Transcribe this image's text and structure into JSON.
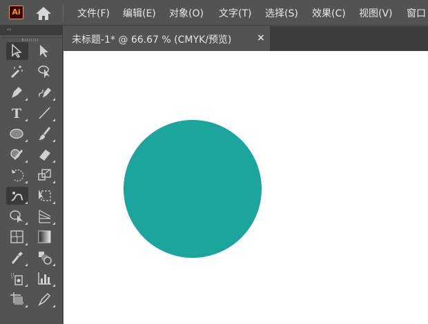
{
  "app": {
    "logo": "Ai"
  },
  "menu": [
    "文件(F)",
    "编辑(E)",
    "对象(O)",
    "文字(T)",
    "选择(S)",
    "效果(C)",
    "视图(V)",
    "窗口"
  ],
  "tools_panel": {
    "collapse": "‹‹"
  },
  "tools": [
    "selection",
    "direct-selection",
    "magic-wand",
    "lasso",
    "pen",
    "curvature",
    "type",
    "line-segment",
    "ellipse",
    "paintbrush",
    "shaper",
    "eraser",
    "rotate",
    "scale",
    "puppet-warp",
    "free-transform",
    "shape-builder",
    "perspective-grid",
    "mesh",
    "gradient",
    "eyedropper",
    "blend",
    "symbol-sprayer",
    "column-graph",
    "artboard",
    "slice"
  ],
  "document": {
    "tab_title": "未标题-1* @ 66.67 % (CMYK/预览)",
    "close": "×"
  },
  "colors": {
    "circle": "#1ba59d"
  }
}
